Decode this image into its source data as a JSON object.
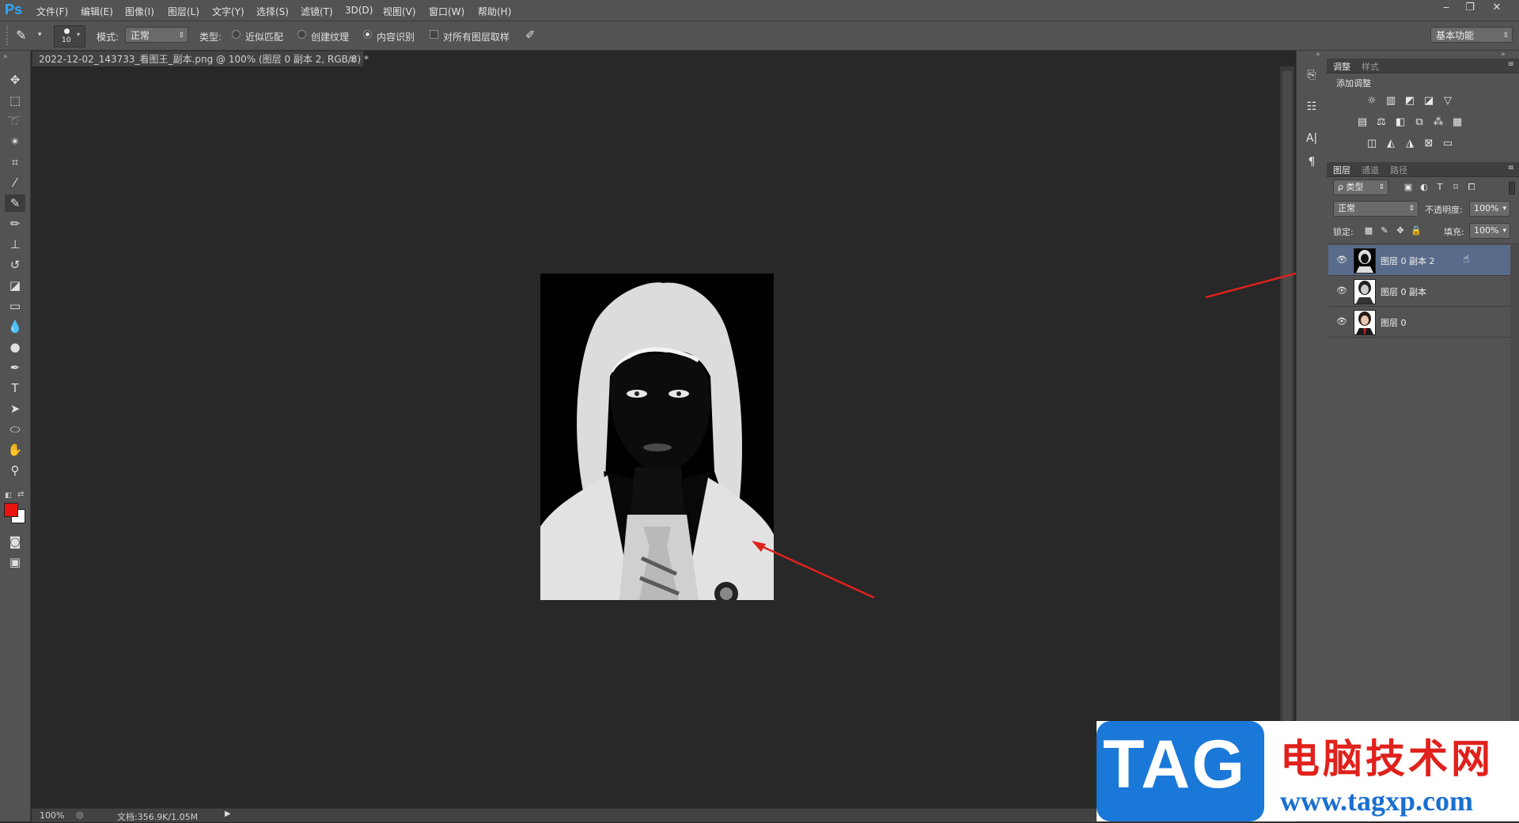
{
  "app": {
    "logo": "Ps"
  },
  "menu": [
    "文件(F)",
    "编辑(E)",
    "图像(I)",
    "图层(L)",
    "文字(Y)",
    "选择(S)",
    "滤镜(T)",
    "3D(D)",
    "视图(V)",
    "窗口(W)",
    "帮助(H)"
  ],
  "options": {
    "brush_size": "10",
    "mode_label": "模式:",
    "mode_value": "正常",
    "type_label": "类型:",
    "radio_1": "近似匹配",
    "radio_2": "创建纹理",
    "radio_3": "内容识别",
    "check_sample": "对所有图层取样",
    "workspace": "基本功能"
  },
  "document": {
    "tab_title": "2022-12-02_143733_看图王_副本.png @ 100% (图层 0 副本 2, RGB/8) *",
    "tab_close": "×",
    "zoom": "100%",
    "doc_info": "文档:356.9K/1.05M"
  },
  "panels": {
    "adjust_tab": "调整",
    "style_tab": "样式",
    "add_adjust": "添加调整",
    "layers_tab": "图层",
    "channels_tab": "通道",
    "paths_tab": "路径",
    "filter_type": "ρ 类型",
    "blend_mode": "正常",
    "opacity_label": "不透明度:",
    "opacity_value": "100%",
    "lock_label": "锁定:",
    "fill_label": "填充:",
    "fill_value": "100%"
  },
  "layers": [
    {
      "name": "图层 0 副本 2",
      "selected": true
    },
    {
      "name": "图层 0 副本",
      "selected": false
    },
    {
      "name": "图层 0",
      "selected": false
    }
  ],
  "colors": {
    "foreground": "#e8150e",
    "background": "#ffffff",
    "accent_arrow": "#e0211c"
  },
  "watermark": {
    "tag": "TAG",
    "cn": "电脑技术网",
    "url": "www.tagxp.com"
  }
}
